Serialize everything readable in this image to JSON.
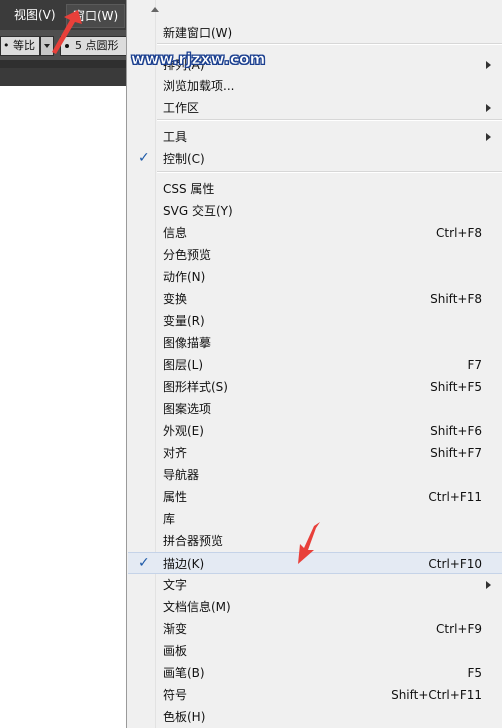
{
  "menubar": {
    "view": "视图(V)",
    "window": "窗口(W)"
  },
  "toolbar": {
    "ratio_label": "• 等比",
    "brush_value": "5 点圆形"
  },
  "watermark": "www.rjzxw.com",
  "menu": {
    "items": [
      {
        "label": "新建窗口(W)",
        "shortcut": "",
        "submenu": false,
        "checked": false
      },
      {
        "label": "排列(A)",
        "shortcut": "",
        "submenu": true,
        "checked": false
      },
      {
        "label": "浏览加载项...",
        "shortcut": "",
        "submenu": false,
        "checked": false
      },
      {
        "label": "工作区",
        "shortcut": "",
        "submenu": true,
        "checked": false
      },
      {
        "label": "工具",
        "shortcut": "",
        "submenu": true,
        "checked": false
      },
      {
        "label": "控制(C)",
        "shortcut": "",
        "submenu": false,
        "checked": true
      },
      {
        "label": "CSS 属性",
        "shortcut": "",
        "submenu": false,
        "checked": false
      },
      {
        "label": "SVG 交互(Y)",
        "shortcut": "",
        "submenu": false,
        "checked": false
      },
      {
        "label": "信息",
        "shortcut": "Ctrl+F8",
        "submenu": false,
        "checked": false
      },
      {
        "label": "分色预览",
        "shortcut": "",
        "submenu": false,
        "checked": false
      },
      {
        "label": "动作(N)",
        "shortcut": "",
        "submenu": false,
        "checked": false
      },
      {
        "label": "变换",
        "shortcut": "Shift+F8",
        "submenu": false,
        "checked": false
      },
      {
        "label": "变量(R)",
        "shortcut": "",
        "submenu": false,
        "checked": false
      },
      {
        "label": "图像描摹",
        "shortcut": "",
        "submenu": false,
        "checked": false
      },
      {
        "label": "图层(L)",
        "shortcut": "F7",
        "submenu": false,
        "checked": false
      },
      {
        "label": "图形样式(S)",
        "shortcut": "Shift+F5",
        "submenu": false,
        "checked": false
      },
      {
        "label": "图案选项",
        "shortcut": "",
        "submenu": false,
        "checked": false
      },
      {
        "label": "外观(E)",
        "shortcut": "Shift+F6",
        "submenu": false,
        "checked": false
      },
      {
        "label": "对齐",
        "shortcut": "Shift+F7",
        "submenu": false,
        "checked": false
      },
      {
        "label": "导航器",
        "shortcut": "",
        "submenu": false,
        "checked": false
      },
      {
        "label": "属性",
        "shortcut": "Ctrl+F11",
        "submenu": false,
        "checked": false
      },
      {
        "label": "库",
        "shortcut": "",
        "submenu": false,
        "checked": false
      },
      {
        "label": "拼合器预览",
        "shortcut": "",
        "submenu": false,
        "checked": false
      },
      {
        "label": "描边(K)",
        "shortcut": "Ctrl+F10",
        "submenu": false,
        "checked": true
      },
      {
        "label": "文字",
        "shortcut": "",
        "submenu": true,
        "checked": false
      },
      {
        "label": "文档信息(M)",
        "shortcut": "",
        "submenu": false,
        "checked": false
      },
      {
        "label": "渐变",
        "shortcut": "Ctrl+F9",
        "submenu": false,
        "checked": false
      },
      {
        "label": "画板",
        "shortcut": "",
        "submenu": false,
        "checked": false
      },
      {
        "label": "画笔(B)",
        "shortcut": "F5",
        "submenu": false,
        "checked": false
      },
      {
        "label": "符号",
        "shortcut": "Shift+Ctrl+F11",
        "submenu": false,
        "checked": false
      },
      {
        "label": "色板(H)",
        "shortcut": "",
        "submenu": false,
        "checked": false
      }
    ]
  },
  "colors": {
    "highlight": "#e4eaf3",
    "check": "#1e5aa8",
    "annotation_arrow": "#e8403a"
  }
}
